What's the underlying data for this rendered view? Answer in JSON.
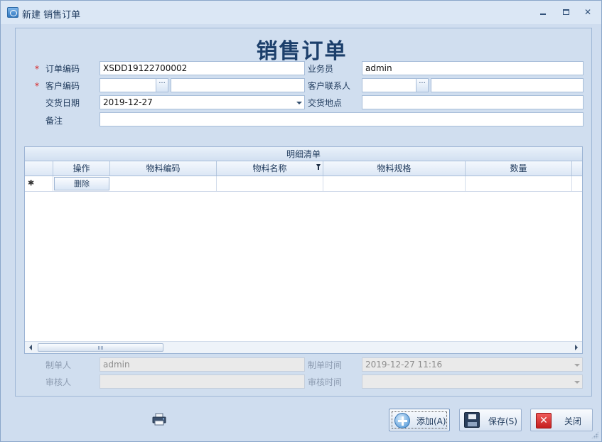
{
  "window": {
    "title": "新建 销售订单"
  },
  "form": {
    "title": "销售订单",
    "required_mark": "*",
    "order_code_label": "订单编码",
    "order_code_value": "XSDD19122700002",
    "salesman_label": "业务员",
    "salesman_value": "admin",
    "customer_code_label": "客户编码",
    "customer_code_value": "",
    "customer_name_value": "",
    "customer_contact_label": "客户联系人",
    "customer_contact_value": "",
    "customer_contact_extra": "",
    "lookup_button": "···",
    "delivery_date_label": "交货日期",
    "delivery_date_value": "2019-12-27",
    "delivery_place_label": "交货地点",
    "delivery_place_value": "",
    "remark_label": "备注",
    "remark_value": ""
  },
  "grid": {
    "caption": "明细清单",
    "columns": [
      "操作",
      "物料编码",
      "物料名称",
      "物料规格",
      "数量"
    ],
    "new_row_marker": "✱",
    "delete_label": "删除"
  },
  "footer": {
    "creator_label": "制单人",
    "creator_value": "admin",
    "create_time_label": "制单时间",
    "create_time_value": "2019-12-27 11:16",
    "auditor_label": "审核人",
    "auditor_value": "",
    "audit_time_label": "审核时间",
    "audit_time_value": ""
  },
  "buttons": {
    "add": "添加(A)",
    "save": "保存(S)",
    "close": "关闭"
  }
}
